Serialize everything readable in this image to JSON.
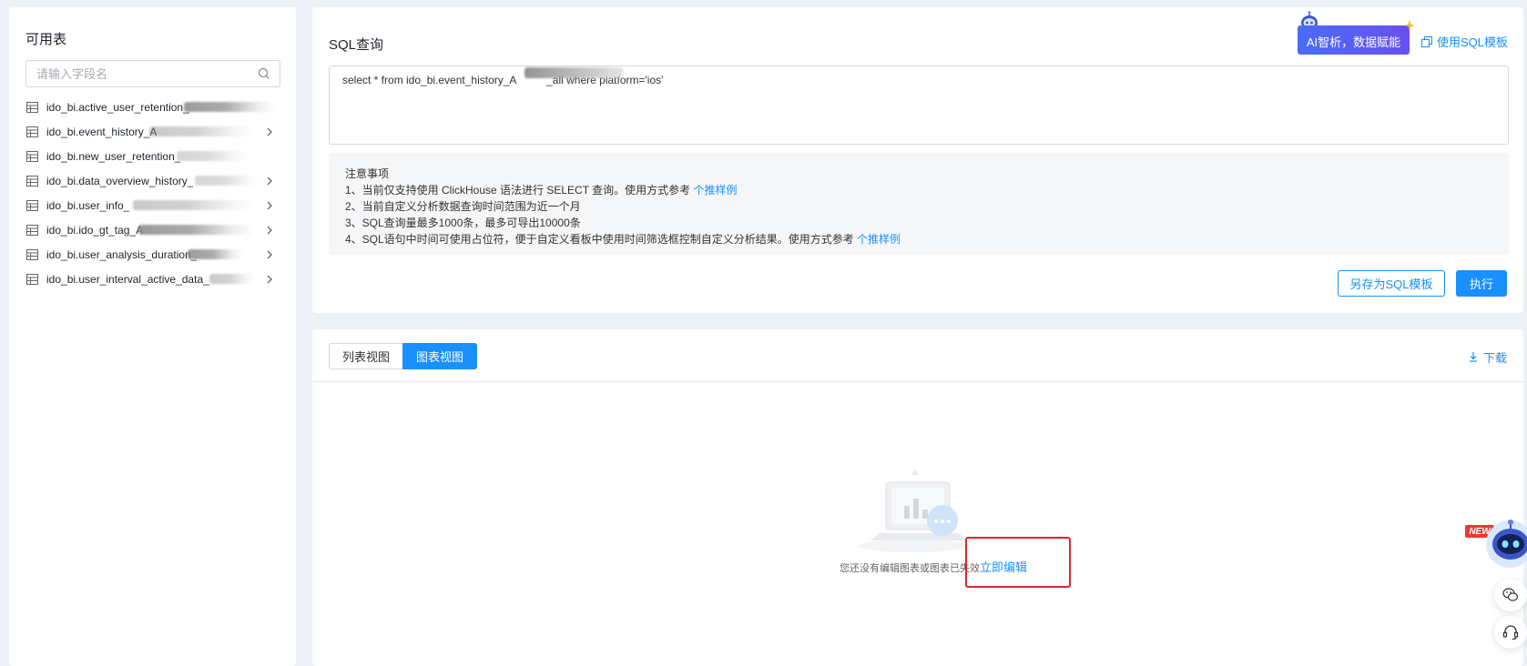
{
  "sidebar": {
    "title": "可用表",
    "search_placeholder": "请输入字段名",
    "tables": [
      {
        "name": "ido_bi.active_user_retention_",
        "has_children": false
      },
      {
        "name": "ido_bi.event_history_A",
        "has_children": true
      },
      {
        "name": "ido_bi.new_user_retention_",
        "has_children": false
      },
      {
        "name": "ido_bi.data_overview_history_",
        "has_children": true
      },
      {
        "name": "ido_bi.user_info_",
        "has_children": true
      },
      {
        "name": "ido_bi.ido_gt_tag_A",
        "has_children": true
      },
      {
        "name": "ido_bi.user_analysis_duration_",
        "has_children": true
      },
      {
        "name": "ido_bi.user_interval_active_data_",
        "has_children": true
      }
    ]
  },
  "sql": {
    "title": "SQL查询",
    "ai_badge": "AI智析，数据赋能",
    "template_link": "使用SQL模板",
    "query": "select * from ido_bi.event_history_A          _all where platform='ios'",
    "notes": {
      "heading": "注意事项",
      "line1": "1、当前仅支持使用 ClickHouse 语法进行 SELECT 查询。使用方式参考",
      "line1_link": "个推样例",
      "line2": "2、当前自定义分析数据查询时间范围为近一个月",
      "line3": "3、SQL查询量最多1000条，最多可导出10000条",
      "line4": "4、SQL语句中时间可使用占位符，便于自定义看板中使用时间筛选框控制自定义分析结果。使用方式参考",
      "line4_link": "个推样例"
    },
    "save_template_button": "另存为SQL模板",
    "execute_button": "执行"
  },
  "result": {
    "tabs": [
      "列表视图",
      "图表视图"
    ],
    "active_tab": 1,
    "download": "下载",
    "empty_text": "您还没有编辑图表或图表已失效",
    "edit_link": "立即编辑"
  },
  "floating": {
    "new_badge": "NEW"
  },
  "colors": {
    "primary": "#1890ff",
    "highlight": "#e0262c",
    "ai_gradient_start": "#4a6cf7"
  }
}
